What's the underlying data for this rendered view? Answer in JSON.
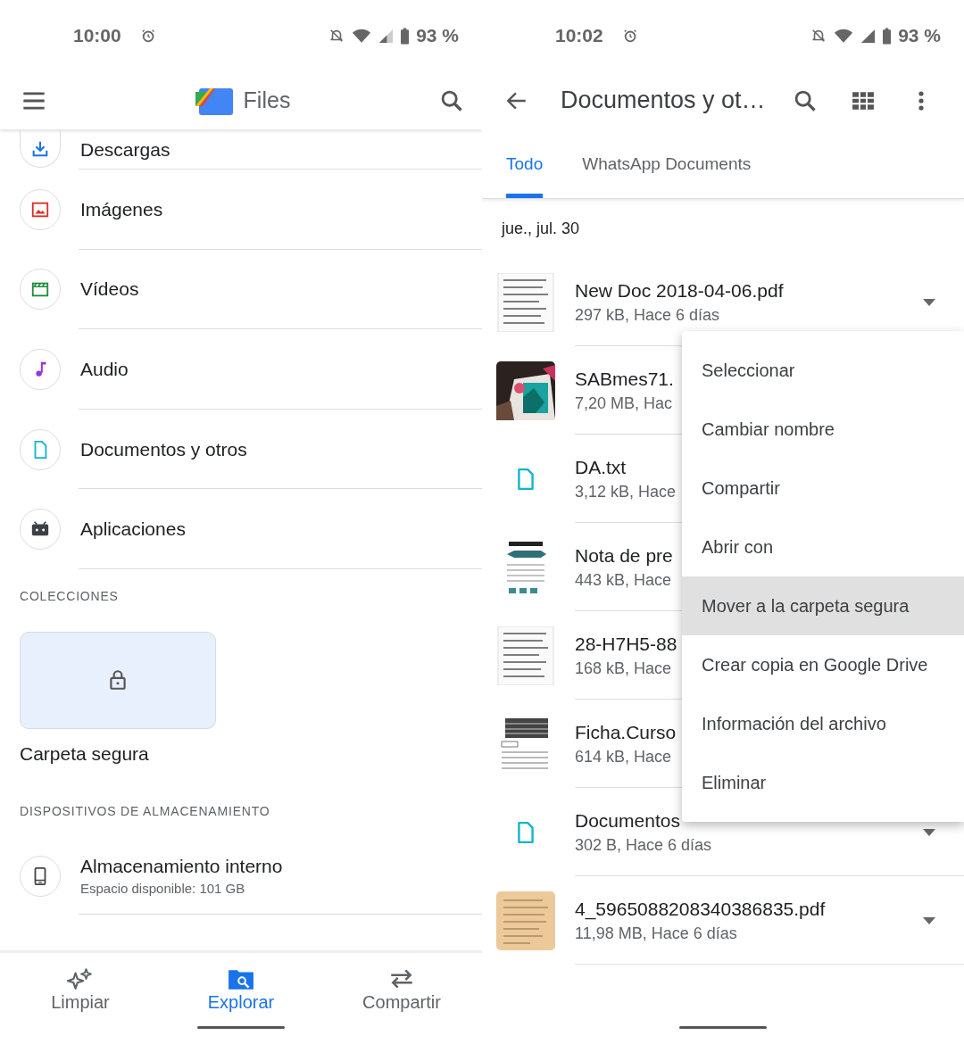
{
  "left_screen": {
    "status_bar": {
      "time": "10:00",
      "battery": "93 %"
    },
    "app_bar": {
      "title": "Files"
    },
    "categories": [
      {
        "label": "Descargas",
        "color": "#1a73e8"
      },
      {
        "label": "Imágenes",
        "color": "#d93025"
      },
      {
        "label": "Vídeos",
        "color": "#1e8e3e"
      },
      {
        "label": "Audio",
        "color": "#9334e6"
      },
      {
        "label": "Documentos y otros",
        "color": "#12b5cb"
      },
      {
        "label": "Aplicaciones",
        "color": "#3c4043"
      }
    ],
    "collections": {
      "heading": "COLECCIONES",
      "card_label": "Carpeta segura"
    },
    "storage": {
      "heading": "DISPOSITIVOS DE ALMACENAMIENTO",
      "title": "Almacenamiento interno",
      "subtitle": "Espacio disponible: 101 GB"
    },
    "bottom_nav": [
      {
        "label": "Limpiar",
        "selected": false
      },
      {
        "label": "Explorar",
        "selected": true
      },
      {
        "label": "Compartir",
        "selected": false
      }
    ]
  },
  "right_screen": {
    "status_bar": {
      "time": "10:02",
      "battery": "93 %"
    },
    "app_bar": {
      "title": "Documentos y ot…"
    },
    "tabs": [
      {
        "label": "Todo",
        "selected": true
      },
      {
        "label": "WhatsApp Documents",
        "selected": false
      }
    ],
    "date_header": "jue., jul. 30",
    "files": [
      {
        "name": "New Doc 2018-04-06.pdf",
        "meta": "297 kB, Hace 6 días",
        "kind": "scan",
        "expand_arrow": true
      },
      {
        "name": "SABmes71.",
        "meta": "7,20 MB, Hac",
        "kind": "picture"
      },
      {
        "name": "DA.txt",
        "meta": "3,12 kB, Hace",
        "kind": "text"
      },
      {
        "name": "Nota de pre",
        "meta": "443 kB, Hace",
        "kind": "newsletter"
      },
      {
        "name": "28-H7H5-88",
        "meta": "168 kB, Hace",
        "kind": "scan"
      },
      {
        "name": "Ficha.Curso",
        "meta": "614 kB, Hace",
        "kind": "form"
      },
      {
        "name": "Documentos",
        "meta": "302 B, Hace 6 días",
        "kind": "text",
        "expand_arrow": true
      },
      {
        "name": "4_5965088208340386835.pdf",
        "meta": "11,98 MB, Hace 6 días",
        "kind": "note",
        "expand_arrow": true
      }
    ],
    "context_menu": [
      {
        "label": "Seleccionar",
        "selected": false
      },
      {
        "label": "Cambiar nombre",
        "selected": false
      },
      {
        "label": "Compartir",
        "selected": false
      },
      {
        "label": "Abrir con",
        "selected": false
      },
      {
        "label": "Mover a la carpeta segura",
        "selected": true
      },
      {
        "label": "Crear copia en Google Drive",
        "selected": false
      },
      {
        "label": "Información del archivo",
        "selected": false
      },
      {
        "label": "Eliminar",
        "selected": false
      }
    ]
  }
}
